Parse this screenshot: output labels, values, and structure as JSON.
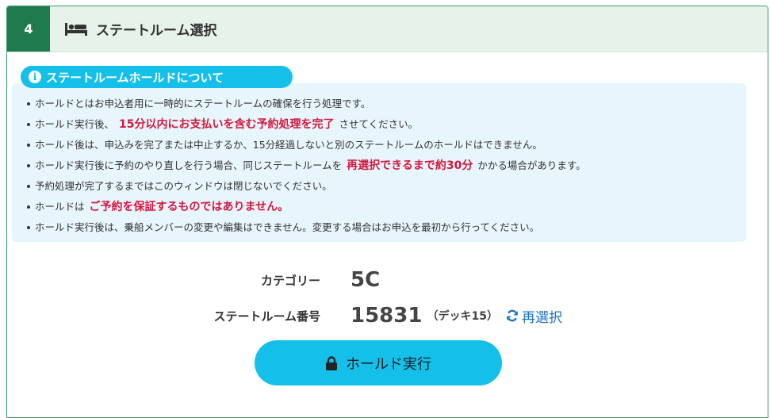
{
  "header": {
    "step_number": "4",
    "title": "ステートルーム選択",
    "icon": "bed-icon"
  },
  "notice": {
    "title": "ステートルームホールドについて",
    "icon": "info-icon",
    "items": [
      {
        "text": "ホールドとはお申込者用に一時的にステートルームの確保を行う処理です。"
      },
      {
        "pre": "ホールド実行後、",
        "em": "15分以内にお支払いを含む予約処理を完了",
        "post": "させてください。"
      },
      {
        "text": "ホールド後は、申込みを完了または中止するか、15分経過しないと別のステートルームのホールドはできません。"
      },
      {
        "pre": "ホールド実行後に予約のやり直しを行う場合、同じステートルームを",
        "em": "再選択できるまで約30分",
        "post": "かかる場合があります。"
      },
      {
        "text": "予約処理が完了するまではこのウィンドウは閉じないでください。"
      },
      {
        "pre": "ホールドは",
        "em": "ご予約を保証するものではありません。",
        "post": ""
      },
      {
        "text": "ホールド実行後は、乗船メンバーの変更や編集はできません。変更する場合はお申込を最初から行ってください。"
      }
    ]
  },
  "selection": {
    "category_label": "カテゴリー",
    "category_value": "5C",
    "room_label": "ステートルーム番号",
    "room_value": "15831",
    "deck_text": "（デッキ15）",
    "reselect_label": "再選択"
  },
  "hold_button": {
    "label": "ホールド実行",
    "icon": "lock-icon"
  },
  "colors": {
    "step_badge": "#1f7a4d",
    "header_bg": "#e6f2ea",
    "accent": "#14c0ea",
    "notice_bg": "#e7f5fc",
    "emphasis": "#d4183d",
    "link": "#1a73c7"
  }
}
